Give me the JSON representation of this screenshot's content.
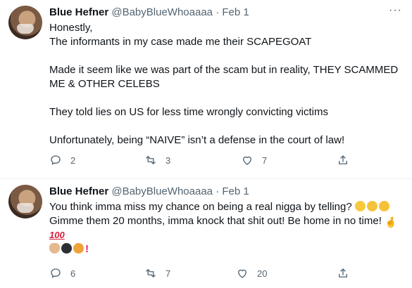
{
  "tweets": [
    {
      "name": "Blue Hefner",
      "handle": "@BabyBlueWhoaaaa",
      "separator": "·",
      "date": "Feb 1",
      "more": "···",
      "paragraphs": [
        "Honestly,",
        "The informants in my case made me their SCAPEGOAT",
        "",
        "Made it seem like we was part of the scam but in reality, THEY SCAMMED ME & OTHER CELEBS",
        "",
        "They told lies on US for less time wrongly convicting victims",
        "",
        "Unfortunately, being “NAIVE” isn’t a defense in the court of law!"
      ],
      "replies": "2",
      "retweets": "3",
      "likes": "7"
    },
    {
      "name": "Blue Hefner",
      "handle": "@BabyBlueWhoaaaa",
      "separator": "·",
      "date": "Feb 1",
      "line1": "You think imma miss my chance on being a real nigga by telling?",
      "line2": "Gimme them 20 months, imma knock that shit out! Be home in no time!",
      "hundred": "100",
      "bang": "!",
      "replies": "6",
      "retweets": "7",
      "likes": "20"
    }
  ],
  "icons": {
    "reply": "reply-icon",
    "retweet": "retweet-icon",
    "like": "heart-icon",
    "share": "share-icon",
    "emojis_line1": [
      "unamused-face",
      "grimacing-face",
      "rolling-laughing-face"
    ],
    "emojis_line2": [
      "crossed-fingers"
    ],
    "emojis_line4": [
      "flexed-biceps",
      "ninja",
      "face-with-steam"
    ],
    "color_icon": "#536471"
  }
}
